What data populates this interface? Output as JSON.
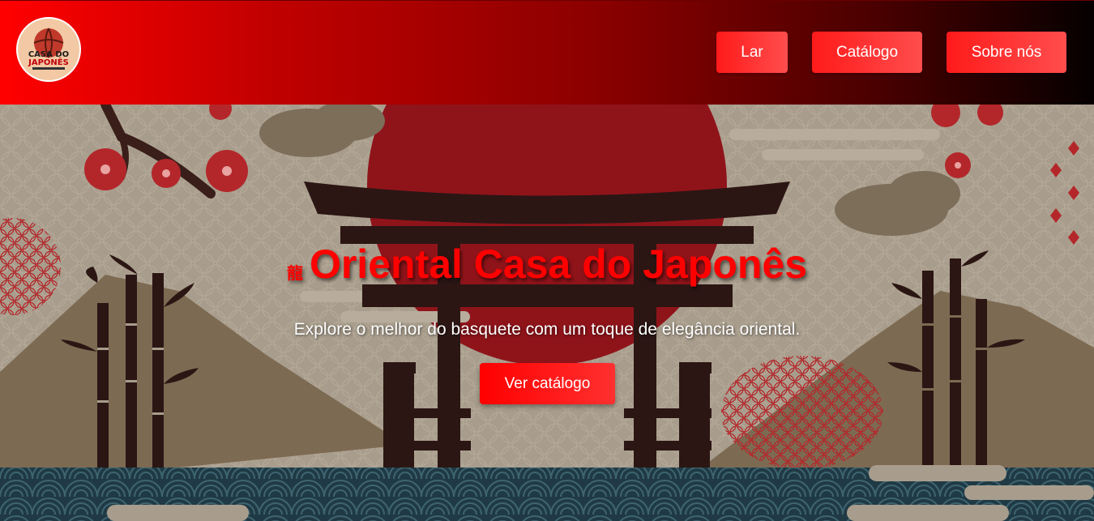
{
  "header": {
    "logo": {
      "icon": "basketball-logo-icon",
      "text_line1": "CASA DO",
      "text_line2": "JAPONÊS"
    },
    "nav": [
      {
        "label": "Lar"
      },
      {
        "label": "Catálogo"
      },
      {
        "label": "Sobre nós"
      }
    ]
  },
  "hero": {
    "title_icon": "龍",
    "title": "Oriental Casa do Japonês",
    "subtitle": "Explore o melhor do basquete com um toque de elegância oriental.",
    "cta_label": "Ver catálogo"
  },
  "colors": {
    "accent": "#ff0000",
    "header_gradient_start": "#ff0000",
    "header_gradient_end": "#050000",
    "hero_background": "#a89d8c"
  }
}
